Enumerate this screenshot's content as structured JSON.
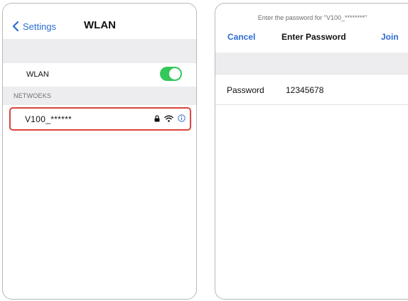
{
  "left_screen": {
    "back_label": "Settings",
    "title": "WLAN",
    "wlan_row_label": "WLAN",
    "wlan_enabled": true,
    "networks_header": "NETWOEKS",
    "network": {
      "name": "V100_******",
      "icons": [
        "lock-icon",
        "wifi-icon",
        "info-icon"
      ]
    }
  },
  "right_screen": {
    "prompt": "Enter the password for \"V100_********\"",
    "cancel_label": "Cancel",
    "title": "Enter Password",
    "join_label": "Join",
    "password_label": "Password",
    "password_value": "12345678"
  },
  "colors": {
    "accent_blue": "#2c6bd3",
    "toggle_green": "#34c759",
    "highlight_red": "#d9453d",
    "band_gray": "#ededf0"
  }
}
